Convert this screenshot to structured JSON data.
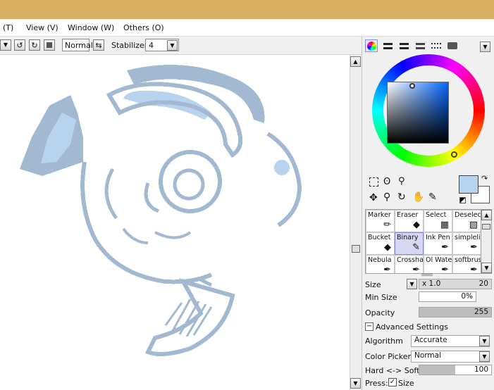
{
  "menu": {
    "items": [
      "(T)",
      "View (V)",
      "Window (W)",
      "Others (O)"
    ]
  },
  "toolbar": {
    "blend_mode": "Normal",
    "stabilizer_label": "Stabilizer",
    "stabilizer_value": "4"
  },
  "colors": {
    "title_bar": "#d9ae60",
    "sketch": "#a3b9d2",
    "sketch_light": "#b8d3ee",
    "main_color": "#b8d3ee",
    "sub_color": "#ffffff"
  },
  "tools": [
    {
      "label": "Marker",
      "icon": "marker-icon"
    },
    {
      "label": "Eraser",
      "icon": "eraser-icon"
    },
    {
      "label": "Select",
      "icon": "select-icon"
    },
    {
      "label": "Deselect",
      "icon": "deselect-icon"
    },
    {
      "label": "Bucket",
      "icon": "bucket-icon"
    },
    {
      "label": "Binary",
      "icon": "binary-icon",
      "selected": true
    },
    {
      "label": "Ink Pen",
      "icon": "ink-pen-icon"
    },
    {
      "label": "simplelin",
      "icon": "brush-icon"
    },
    {
      "label": "Nebula",
      "icon": "nebula-icon"
    },
    {
      "label": "Crosshat",
      "icon": "crosshatch-icon"
    },
    {
      "label": "Ol Wate",
      "icon": "watercolor-icon"
    },
    {
      "label": "softbrush",
      "icon": "softbrush-icon"
    }
  ],
  "properties": {
    "size_label": "Size",
    "size_multiplier": "x 1.0",
    "size_value": "20",
    "min_size_label": "Min Size",
    "min_size_value": "0%",
    "opacity_label": "Opacity",
    "opacity_value": "255",
    "advanced_label": "Advanced Settings",
    "algorithm_label": "Algorithm",
    "algorithm_value": "Accurate",
    "color_picker_label": "Color Picker",
    "color_picker_value": "Normal",
    "hard_soft_label": "Hard <-> Soft",
    "hard_soft_value": "100",
    "press_label": "Press:",
    "press_size_label": "Size"
  }
}
